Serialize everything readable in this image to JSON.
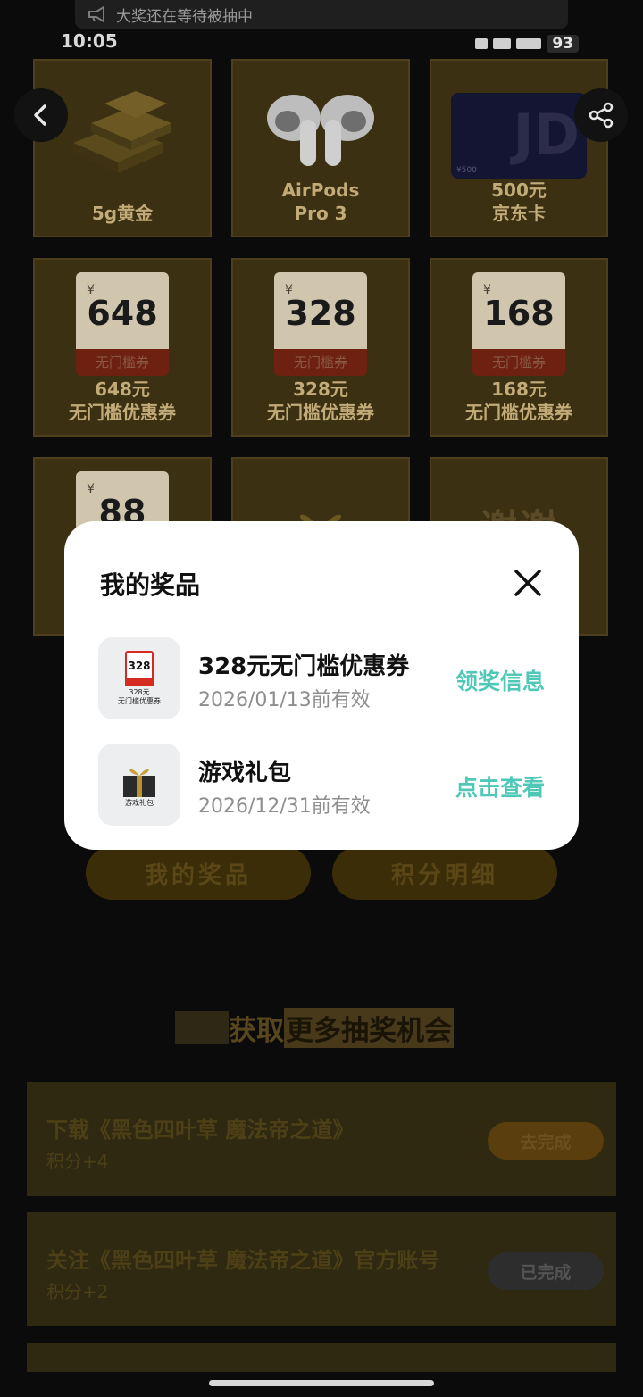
{
  "banner": {
    "text": "大奖还在等待被抽中",
    "icon": "megaphone-icon"
  },
  "status": {
    "time": "10:05",
    "battery": "93"
  },
  "nav": {
    "back_icon": "chevron-left-icon",
    "share_icon": "share-icon"
  },
  "prizes": [
    {
      "label": "5g黄金",
      "art": "gold-bars"
    },
    {
      "label": "AirPods\nPro 3",
      "art": "airpods"
    },
    {
      "label": "500元\n京东卡",
      "art": "jd-card",
      "card_text": "JD",
      "card_value": "¥500"
    },
    {
      "label": "648元\n无门槛优惠券",
      "art": "coupon",
      "yen": "¥",
      "amount": "648",
      "tag": "无门槛券"
    },
    {
      "label": "328元\n无门槛优惠券",
      "art": "coupon",
      "yen": "¥",
      "amount": "328",
      "tag": "无门槛券"
    },
    {
      "label": "168元\n无门槛优惠券",
      "art": "coupon",
      "yen": "¥",
      "amount": "168",
      "tag": "无门槛券"
    },
    {
      "label": "",
      "art": "coupon",
      "yen": "¥",
      "amount": "88",
      "tag": ""
    },
    {
      "label": "",
      "art": "gift-box"
    },
    {
      "label": "",
      "art": "thanks",
      "art_text": "谢谢"
    }
  ],
  "buttons": {
    "my_prizes": "我的奖品",
    "points_detail": "积分明细"
  },
  "section": {
    "prefix": "获取",
    "highlight": "更多抽奖机会"
  },
  "tasks": [
    {
      "title": "下载《黑色四叶草 魔法帝之道》",
      "points": "积分+4",
      "action": "去完成",
      "state": "todo"
    },
    {
      "title": "关注《黑色四叶草 魔法帝之道》官方账号",
      "points": "积分+2",
      "action": "已完成",
      "state": "done"
    }
  ],
  "modal": {
    "title": "我的奖品",
    "close_icon": "close-icon",
    "items": [
      {
        "name": "328元无门槛优惠券",
        "date": "2026/01/13前有效",
        "action": "领奖信息",
        "thumb_amount": "328",
        "thumb_text": "328元\n无门槛优惠券"
      },
      {
        "name": "游戏礼包",
        "date": "2026/12/31前有效",
        "action": "点击查看",
        "thumb_text": "游戏礼包"
      }
    ],
    "accent_color": "#50c8b8"
  }
}
